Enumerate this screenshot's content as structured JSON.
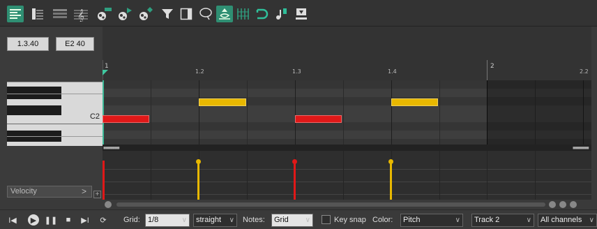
{
  "toolbar": {
    "buttons": [
      {
        "icon": "piano-roll-view-icon",
        "active": true
      },
      {
        "icon": "named-notes-view-icon",
        "active": false
      },
      {
        "icon": "event-list-view-icon",
        "active": false
      },
      {
        "icon": "musical-notation-icon",
        "active": false
      },
      {
        "icon": "insert-note-icon",
        "active": false
      },
      {
        "icon": "insert-note-right-icon",
        "active": false
      },
      {
        "icon": "insert-note-diamond-icon",
        "active": false
      },
      {
        "icon": "filter-icon",
        "active": false
      },
      {
        "icon": "toggle-sidebar-icon",
        "active": false
      },
      {
        "icon": "lasso-select-icon",
        "active": false
      },
      {
        "icon": "snap-to-grid-icon",
        "active": true
      },
      {
        "icon": "grid-lines-icon",
        "active": false
      },
      {
        "icon": "loop-icon",
        "active": false
      },
      {
        "icon": "step-input-icon",
        "active": false
      },
      {
        "icon": "record-input-icon",
        "active": false
      }
    ]
  },
  "position": {
    "time": "1.3.40",
    "note": "E2  40"
  },
  "ruler": {
    "bars": [
      "1",
      "2"
    ],
    "beats": [
      "1.2",
      "1.3",
      "1.4",
      "2.2"
    ]
  },
  "piano": {
    "c_label": "C2"
  },
  "colors": {
    "note_yellow": "#e8b800",
    "note_red": "#e01818",
    "accent": "#2f8f73"
  },
  "notes": [
    {
      "pitch": "C2",
      "start": "1.1",
      "color": "red"
    },
    {
      "pitch": "E2",
      "start": "1.2",
      "color": "yellow"
    },
    {
      "pitch": "C2",
      "start": "1.3",
      "color": "red"
    },
    {
      "pitch": "E2",
      "start": "1.4",
      "color": "yellow"
    }
  ],
  "lane": {
    "label": "Velocity"
  },
  "bottom": {
    "grid_label": "Grid:",
    "grid_value": "1/8",
    "swing_value": "straight",
    "notes_label": "Notes:",
    "notes_value": "Grid",
    "key_snap_label": "Key snap",
    "key_snap_checked": false,
    "color_label": "Color:",
    "color_value": "Pitch",
    "track_value": "Track 2",
    "channel_value": "All channels"
  }
}
